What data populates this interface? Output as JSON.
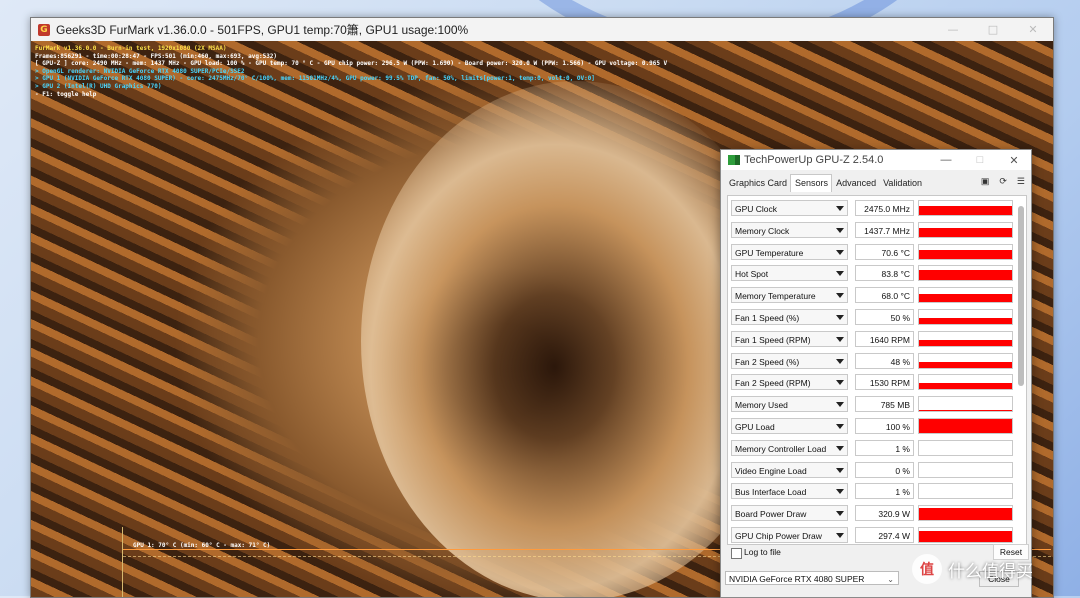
{
  "colors": {
    "graph_line": "#ff9a3c",
    "sensor_bar": "#ff0000",
    "overlay_yellow": "#ffe24a",
    "overlay_cyan": "#47d6ff"
  },
  "furmark": {
    "title": "Geeks3D FurMark v1.36.0.0 - 501FPS, GPU1 temp:70簫, GPU1 usage:100%",
    "overlay": [
      {
        "text": "FurMark v1.36.0.0 - Burn-in test, 1920x1080 (2X MSAA)",
        "color": "yellow"
      },
      {
        "text": "Frames:856291 - time:00:28:47 - FPS:501 (min:460, max:693, avg:532)",
        "color": "white"
      },
      {
        "text": "[ GPU-Z ] core: 2490 MHz - mem: 1437 MHz - GPU load: 100 % - GPU temp: 70 ° C - GPU chip power: 296.5 W (PPW: 1.690) - Board power: 320.0 W (PPW: 1.566) - GPU voltage: 0.965 V",
        "color": "white"
      },
      {
        "text": "> OpenGL renderer: NVIDIA GeForce RTX 4080 SUPER/PCIe/SSE2",
        "color": "cyan"
      },
      {
        "text": "> GPU 1 (NVIDIA GeForce RTX 4080 SUPER) - core: 2475MHz/70° C/100%, mem: 11501MHz/4%, GPU power: 99.5% TDP, fan: 50%, limits[power:1, temp:0, volt:0, OV:0]",
        "color": "cyan"
      },
      {
        "text": "> GPU 2 (Intel(R) UHD Graphics 770)",
        "color": "cyan"
      },
      {
        "text": "- F1: toggle help",
        "color": "white"
      }
    ],
    "graph_label": "GPU 1: 70° C (min: 60° C - max: 71° C)"
  },
  "gpuz": {
    "title": "TechPowerUp GPU-Z 2.54.0",
    "tabs": [
      "Graphics Card",
      "Sensors",
      "Advanced",
      "Validation"
    ],
    "active_tab": "Sensors",
    "sensors": [
      {
        "name": "GPU Clock",
        "value": "2475.0 MHz",
        "level": 0.62
      },
      {
        "name": "Memory Clock",
        "value": "1437.7 MHz",
        "level": 0.62
      },
      {
        "name": "GPU Temperature",
        "value": "70.6 °C",
        "level": 0.65
      },
      {
        "name": "Hot Spot",
        "value": "83.8 °C",
        "level": 0.7
      },
      {
        "name": "Memory Temperature",
        "value": "68.0 °C",
        "level": 0.55
      },
      {
        "name": "Fan 1 Speed (%)",
        "value": "50 %",
        "level": 0.42
      },
      {
        "name": "Fan 1 Speed (RPM)",
        "value": "1640 RPM",
        "level": 0.42
      },
      {
        "name": "Fan 2 Speed (%)",
        "value": "48 %",
        "level": 0.4
      },
      {
        "name": "Fan 2 Speed (RPM)",
        "value": "1530 RPM",
        "level": 0.4
      },
      {
        "name": "Memory Used",
        "value": "785 MB",
        "level": 0.06
      },
      {
        "name": "GPU Load",
        "value": "100 %",
        "level": 1.0
      },
      {
        "name": "Memory Controller Load",
        "value": "1 %",
        "level": 0.0
      },
      {
        "name": "Video Engine Load",
        "value": "0 %",
        "level": 0.0
      },
      {
        "name": "Bus Interface Load",
        "value": "1 %",
        "level": 0.02
      },
      {
        "name": "Board Power Draw",
        "value": "320.9 W",
        "level": 0.85
      },
      {
        "name": "GPU Chip Power Draw",
        "value": "297.4 W",
        "level": 0.8
      }
    ],
    "log_label": "Log to file",
    "reset_label": "Reset",
    "gpu_select": "NVIDIA GeForce RTX 4080 SUPER",
    "close_label": "Close"
  },
  "watermark": {
    "text": "什么值得买",
    "logo": "值"
  }
}
